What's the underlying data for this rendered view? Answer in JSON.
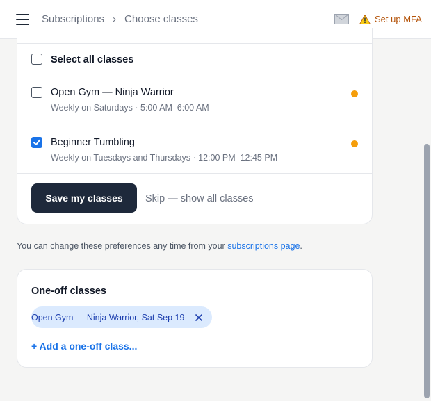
{
  "header": {
    "breadcrumb": [
      "Subscriptions",
      "Choose classes"
    ],
    "separator": "›",
    "mfa_label": "Set up MFA",
    "icons": [
      "menu-icon",
      "mail-icon",
      "warning-icon"
    ],
    "mfa_color": "#b45309"
  },
  "classes": {
    "select_all_label": "Select all classes",
    "items": [
      {
        "name": "Open Gym — Ninja Warrior",
        "schedule": "Weekly on Saturdays · 5:00 AM–6:00 AM",
        "checked": false
      },
      {
        "name": "Beginner Tumbling",
        "schedule": "Weekly on Tuesdays and Thursdays · 12:00 PM–12:45 PM",
        "checked": true
      }
    ],
    "save_label": "Save my classes",
    "skip_label": "Skip — show all classes"
  },
  "note": {
    "prefix": "You can change these preferences any time from your ",
    "link": "subscriptions page",
    "suffix": "."
  },
  "oneoff": {
    "title": "One-off classes",
    "chip_label": "Open Gym — Ninja Warrior, Sat Sep 19",
    "add_label": "+ Add a one-off class..."
  },
  "colors": {
    "accent": "#1a73e8",
    "status_dot": "#f59e0b",
    "primary_button": "#1e293b",
    "chip_bg": "#dbeafe"
  }
}
